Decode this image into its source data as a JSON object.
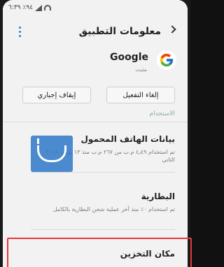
{
  "status_bar": {
    "time": "٦:٣٩",
    "battery": "٪٩٤"
  },
  "app_bar": {
    "title": "معلومات التطبيق",
    "back_icon": "chevron-left-icon",
    "more_icon": "more-vertical-icon"
  },
  "app": {
    "name": "Google",
    "status": "مثبت",
    "icon": "google-g-icon"
  },
  "buttons": {
    "disable": "إلغاء التفعيل",
    "force_stop": "إيقاف إجباري"
  },
  "section": {
    "usage_label": "الاستخدام"
  },
  "items": [
    {
      "title": "بيانات الهاتف المحمول",
      "subtitle": "تم استخدام ٤٫٤٩ م.ب من ٢٦٧ م.ب منذ ١٣ يونيو، ٢٠١٨ الثاني"
    },
    {
      "title": "البطارية",
      "subtitle": "تم استخدام ٠٪ منذ آخر عملية شحن البطارية بالكامل"
    },
    {
      "title": "مكان التخزين",
      "subtitle": ""
    }
  ],
  "colors": {
    "accent": "#2a7fd4",
    "highlight": "#e53935",
    "watermark": "#2f78c8"
  }
}
